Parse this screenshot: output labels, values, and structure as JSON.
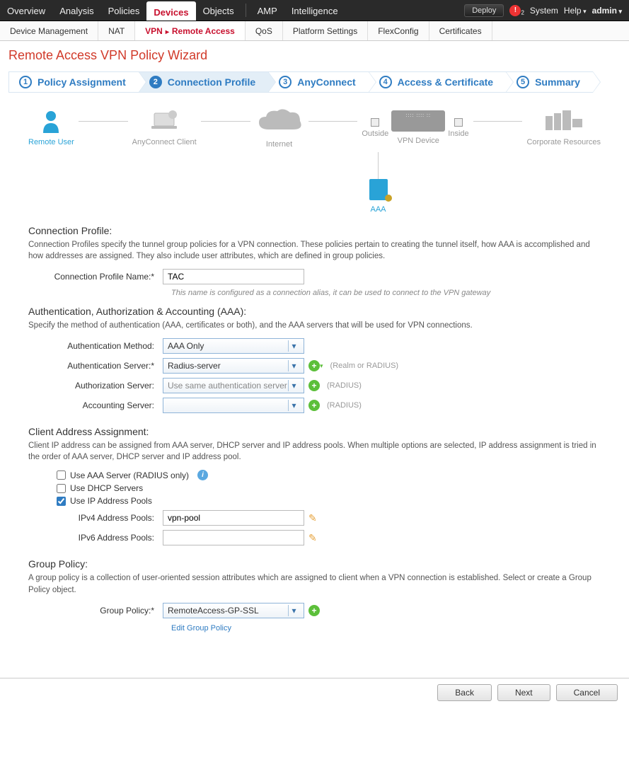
{
  "topnav": {
    "tabs": [
      "Overview",
      "Analysis",
      "Policies",
      "Devices",
      "Objects"
    ],
    "right_tabs": [
      "AMP",
      "Intelligence"
    ],
    "active": "Devices",
    "deploy": "Deploy",
    "alert_count": "2",
    "system": "System",
    "help": "Help",
    "user": "admin"
  },
  "subnav": {
    "items": [
      {
        "label": "Device Management"
      },
      {
        "label": "NAT"
      },
      {
        "label": "VPN",
        "crumb": "Remote Access",
        "active": true
      },
      {
        "label": "QoS"
      },
      {
        "label": "Platform Settings"
      },
      {
        "label": "FlexConfig"
      },
      {
        "label": "Certificates"
      }
    ]
  },
  "page_title": "Remote Access VPN Policy Wizard",
  "wizard_steps": [
    {
      "num": "1",
      "label": "Policy Assignment"
    },
    {
      "num": "2",
      "label": "Connection Profile"
    },
    {
      "num": "3",
      "label": "AnyConnect"
    },
    {
      "num": "4",
      "label": "Access & Certificate"
    },
    {
      "num": "5",
      "label": "Summary"
    }
  ],
  "wizard_active": 1,
  "topology": {
    "remote_user": "Remote User",
    "anyconnect": "AnyConnect Client",
    "internet": "Internet",
    "outside": "Outside",
    "vpn_device": "VPN Device",
    "inside": "Inside",
    "corporate": "Corporate Resources",
    "aaa": "AAA"
  },
  "section_profile": {
    "title": "Connection Profile:",
    "desc": "Connection Profiles specify the tunnel group policies for a VPN connection. These policies pertain to creating the tunnel itself, how AAA is accomplished and how addresses are assigned. They also include user attributes, which are defined in group policies.",
    "name_label": "Connection Profile Name:*",
    "name_value": "TAC",
    "name_note": "This name is configured as a connection alias, it can be used to connect to the VPN gateway"
  },
  "section_aaa": {
    "title": "Authentication, Authorization & Accounting (AAA):",
    "desc": "Specify the method of authentication (AAA, certificates or both), and the AAA servers that will be used for VPN connections.",
    "auth_method_label": "Authentication Method:",
    "auth_method_value": "AAA Only",
    "auth_server_label": "Authentication Server:*",
    "auth_server_value": "Radius-server",
    "auth_server_hint": "(Realm or RADIUS)",
    "authz_server_label": "Authorization Server:",
    "authz_server_value": "Use same authentication server",
    "authz_server_hint": "(RADIUS)",
    "acct_server_label": "Accounting Server:",
    "acct_server_value": "",
    "acct_server_hint": "(RADIUS)"
  },
  "section_addr": {
    "title": "Client Address Assignment:",
    "desc": "Client IP address can be assigned from AAA server, DHCP server and IP address pools. When multiple options are selected, IP address assignment is tried in the order of AAA server, DHCP server and IP address pool.",
    "use_aaa_label": "Use AAA Server (RADIUS only)",
    "use_dhcp_label": "Use DHCP Servers",
    "use_pools_label": "Use IP Address Pools",
    "ipv4_label": "IPv4 Address Pools:",
    "ipv4_value": "vpn-pool",
    "ipv6_label": "IPv6 Address Pools:",
    "ipv6_value": ""
  },
  "section_gp": {
    "title": "Group Policy:",
    "desc": "A group policy is a collection of user-oriented session attributes which are assigned to client when a VPN connection is established. Select or create a Group Policy object.",
    "label": "Group Policy:*",
    "value": "RemoteAccess-GP-SSL",
    "edit_link": "Edit Group Policy"
  },
  "buttons": {
    "back": "Back",
    "next": "Next",
    "cancel": "Cancel"
  }
}
